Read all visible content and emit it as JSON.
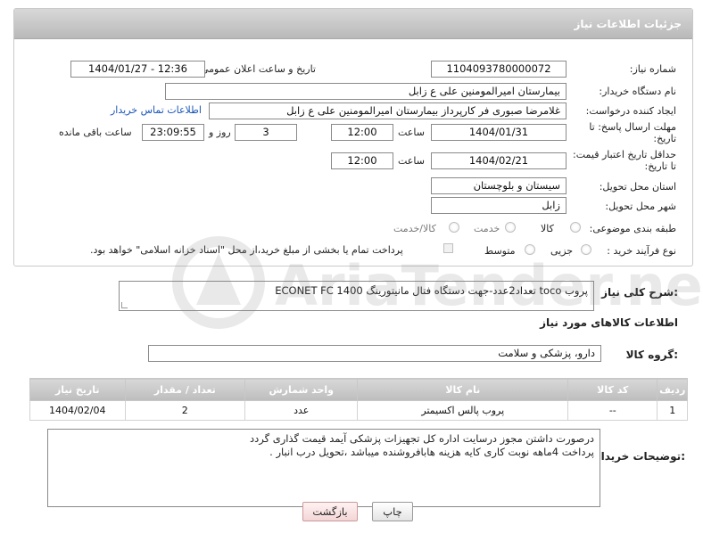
{
  "header": {
    "title": "جزئیات اطلاعات نیاز"
  },
  "form": {
    "need_number_label": "شماره نیاز:",
    "need_number": "1104093780000072",
    "announce_label": "تاریخ و ساعت اعلان عمومی:",
    "announce_value": "1404/01/27 - 12:36",
    "buyer_org_label": "نام دستگاه خریدار:",
    "buyer_org": "بیمارستان امیرالمومنین علی  ع  زابل",
    "creator_label": "ایجاد کننده درخواست:",
    "creator": "غلامرضا صبوری فر کارپرداز بیمارستان امیرالمومنین علی  ع  زابل",
    "contact_link": "اطلاعات تماس خریدار",
    "reply_deadline_label_1": "مهلت ارسال پاسخ: تا",
    "reply_deadline_label_2": "تاریخ:",
    "reply_date": "1404/01/31",
    "time_label": "ساعت",
    "reply_time": "12:00",
    "days_value": "3",
    "days_label": "روز و",
    "remaining_time": "23:09:55",
    "remaining_label": "ساعت باقی مانده",
    "price_validity_label_1": "حداقل تاریخ اعتبار قیمت:",
    "price_validity_label_2": "تا تاریخ:",
    "price_date": "1404/02/21",
    "price_time": "12:00",
    "province_label": "استان محل تحویل:",
    "province": "سیستان و بلوچستان",
    "city_label": "شهر محل تحویل:",
    "city": "زابل",
    "category_label": "طبقه بندی موضوعی:",
    "category_options": [
      "کالا",
      "خدمت",
      "کالا/خدمت"
    ],
    "process_label": "نوع فرآیند خرید :",
    "process_options": [
      "جزیی",
      "متوسط"
    ],
    "payment_note": "پرداخت تمام یا بخشی از مبلغ خرید،از محل \"اسناد خزانه اسلامی\" خواهد بود."
  },
  "description": {
    "label": "شرح کلی نیاز:",
    "text": "پروب  toco  تعداد2عدد-جهت دستگاه فتال مانیتورینگ  ECONET FC 1400"
  },
  "goods": {
    "section_title": "اطلاعات کالاهای مورد نیاز",
    "group_label": "گروه کالا:",
    "group_value": "دارو، پزشکی و سلامت",
    "columns": [
      "ردیف",
      "کد کالا",
      "نام کالا",
      "واحد شمارش",
      "تعداد / مقدار",
      "تاریخ نیاز"
    ],
    "rows": [
      [
        "1",
        "--",
        "پروب پالس اکسیمتر",
        "عدد",
        "2",
        "1404/02/04"
      ]
    ]
  },
  "buyer_notes": {
    "label": "توضیحات خریدار:",
    "line1": "درصورت داشتن مجوز درسایت اداره کل تجهیزات پزشکی آیمد قیمت گذاری گردد",
    "line2": "پرداخت 4ماهه نوبت کاری کایه هزینه هابافروشنده میباشد ،تحویل درب انبار ."
  },
  "actions": {
    "print": "چاپ",
    "back": "بازگشت"
  },
  "watermark": "AriaTender.neT"
}
